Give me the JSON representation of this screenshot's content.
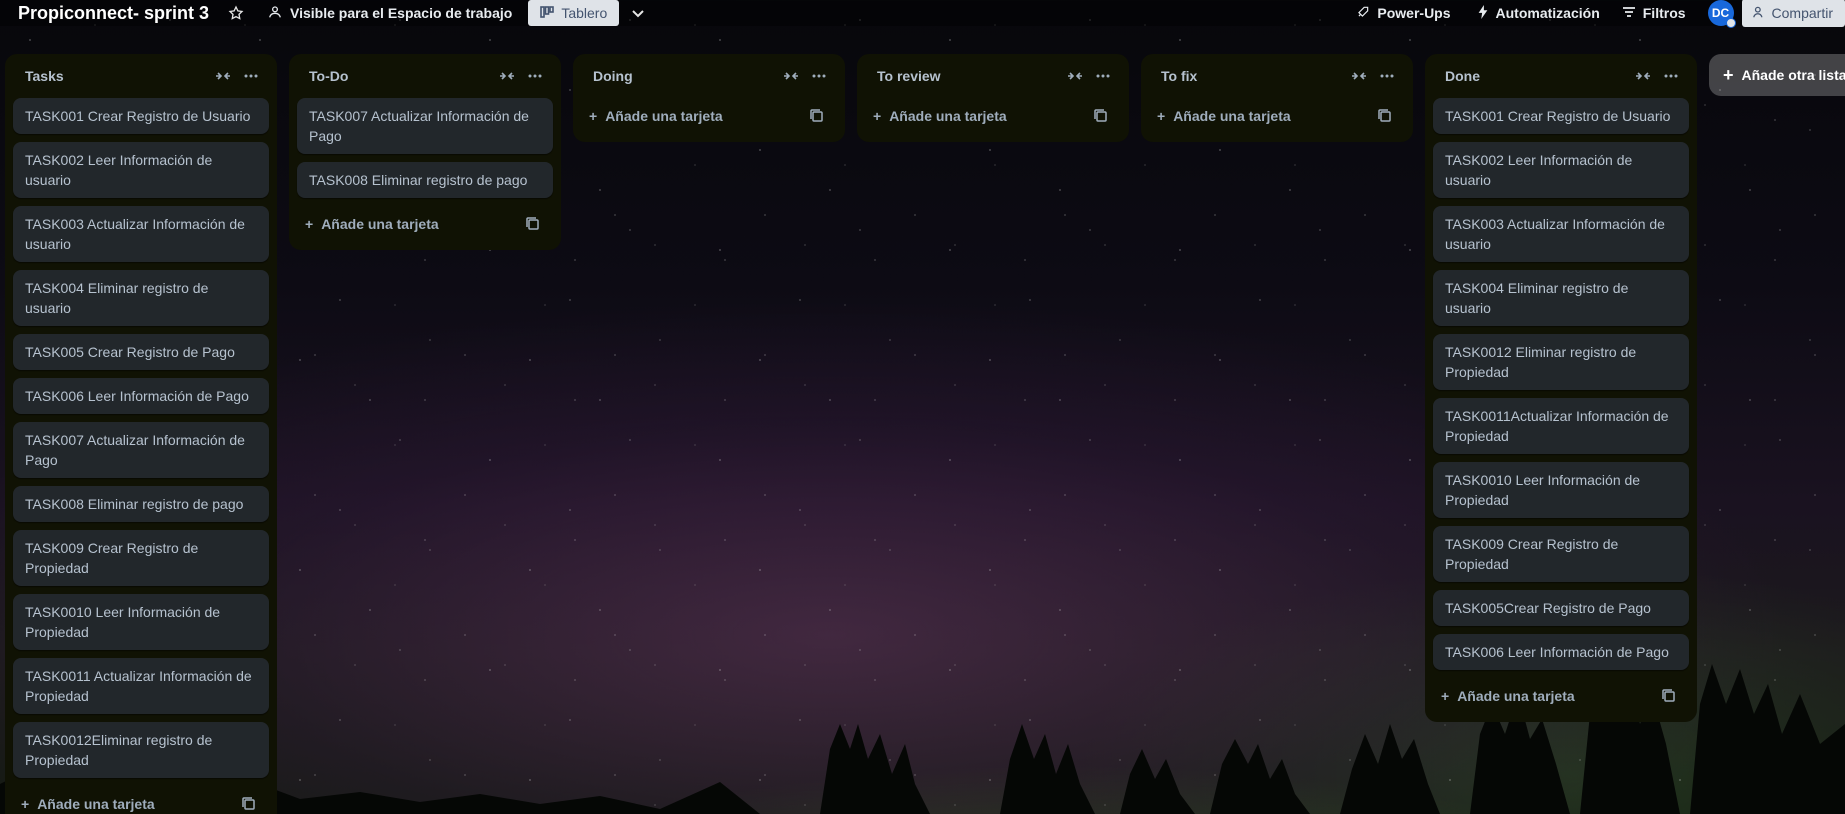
{
  "topbar": {
    "board_title": "Propiconnect- sprint 3",
    "visibility_label": "Visible para el Espacio de trabajo",
    "view_label": "Tablero",
    "powerups_label": "Power-Ups",
    "automation_label": "Automatización",
    "filters_label": "Filtros",
    "avatar_initials": "DC",
    "share_label": "Compartir"
  },
  "lists": [
    {
      "title": "Tasks",
      "cards": [
        "TASK001 Crear Registro de Usuario",
        "TASK002 Leer Información de usuario",
        "TASK003 Actualizar Información de usuario",
        "TASK004 Eliminar registro de usuario",
        "TASK005 Crear Registro de Pago",
        "TASK006 Leer Información de Pago",
        "TASK007 Actualizar Información de Pago",
        "TASK008 Eliminar registro de pago",
        "TASK009 Crear Registro de Propiedad",
        "TASK0010 Leer Información de Propiedad",
        "TASK0011 Actualizar Información de Propiedad",
        "TASK0012Eliminar registro de Propiedad"
      ],
      "add_card_label": "Añade una tarjeta"
    },
    {
      "title": "To-Do",
      "cards": [
        "TASK007 Actualizar Información de Pago",
        "TASK008 Eliminar registro de pago"
      ],
      "add_card_label": "Añade una tarjeta"
    },
    {
      "title": "Doing",
      "cards": [],
      "add_card_label": "Añade una tarjeta"
    },
    {
      "title": "To review",
      "cards": [],
      "add_card_label": "Añade una tarjeta"
    },
    {
      "title": "To fix",
      "cards": [],
      "add_card_label": "Añade una tarjeta"
    },
    {
      "title": "Done",
      "cards": [
        "TASK001 Crear Registro de Usuario",
        "TASK002 Leer Información de usuario",
        "TASK003 Actualizar Información de usuario",
        "TASK004 Eliminar registro de usuario",
        "TASK0012 Eliminar registro de Propiedad",
        "TASK0011Actualizar Información de Propiedad",
        "TASK0010 Leer Información de Propiedad",
        "TASK009 Crear Registro de Propiedad",
        "TASK005Crear Registro de Pago",
        "TASK006 Leer Información de Pago"
      ],
      "add_card_label": "Añade una tarjeta"
    }
  ],
  "add_list_label": "Añade otra lista"
}
